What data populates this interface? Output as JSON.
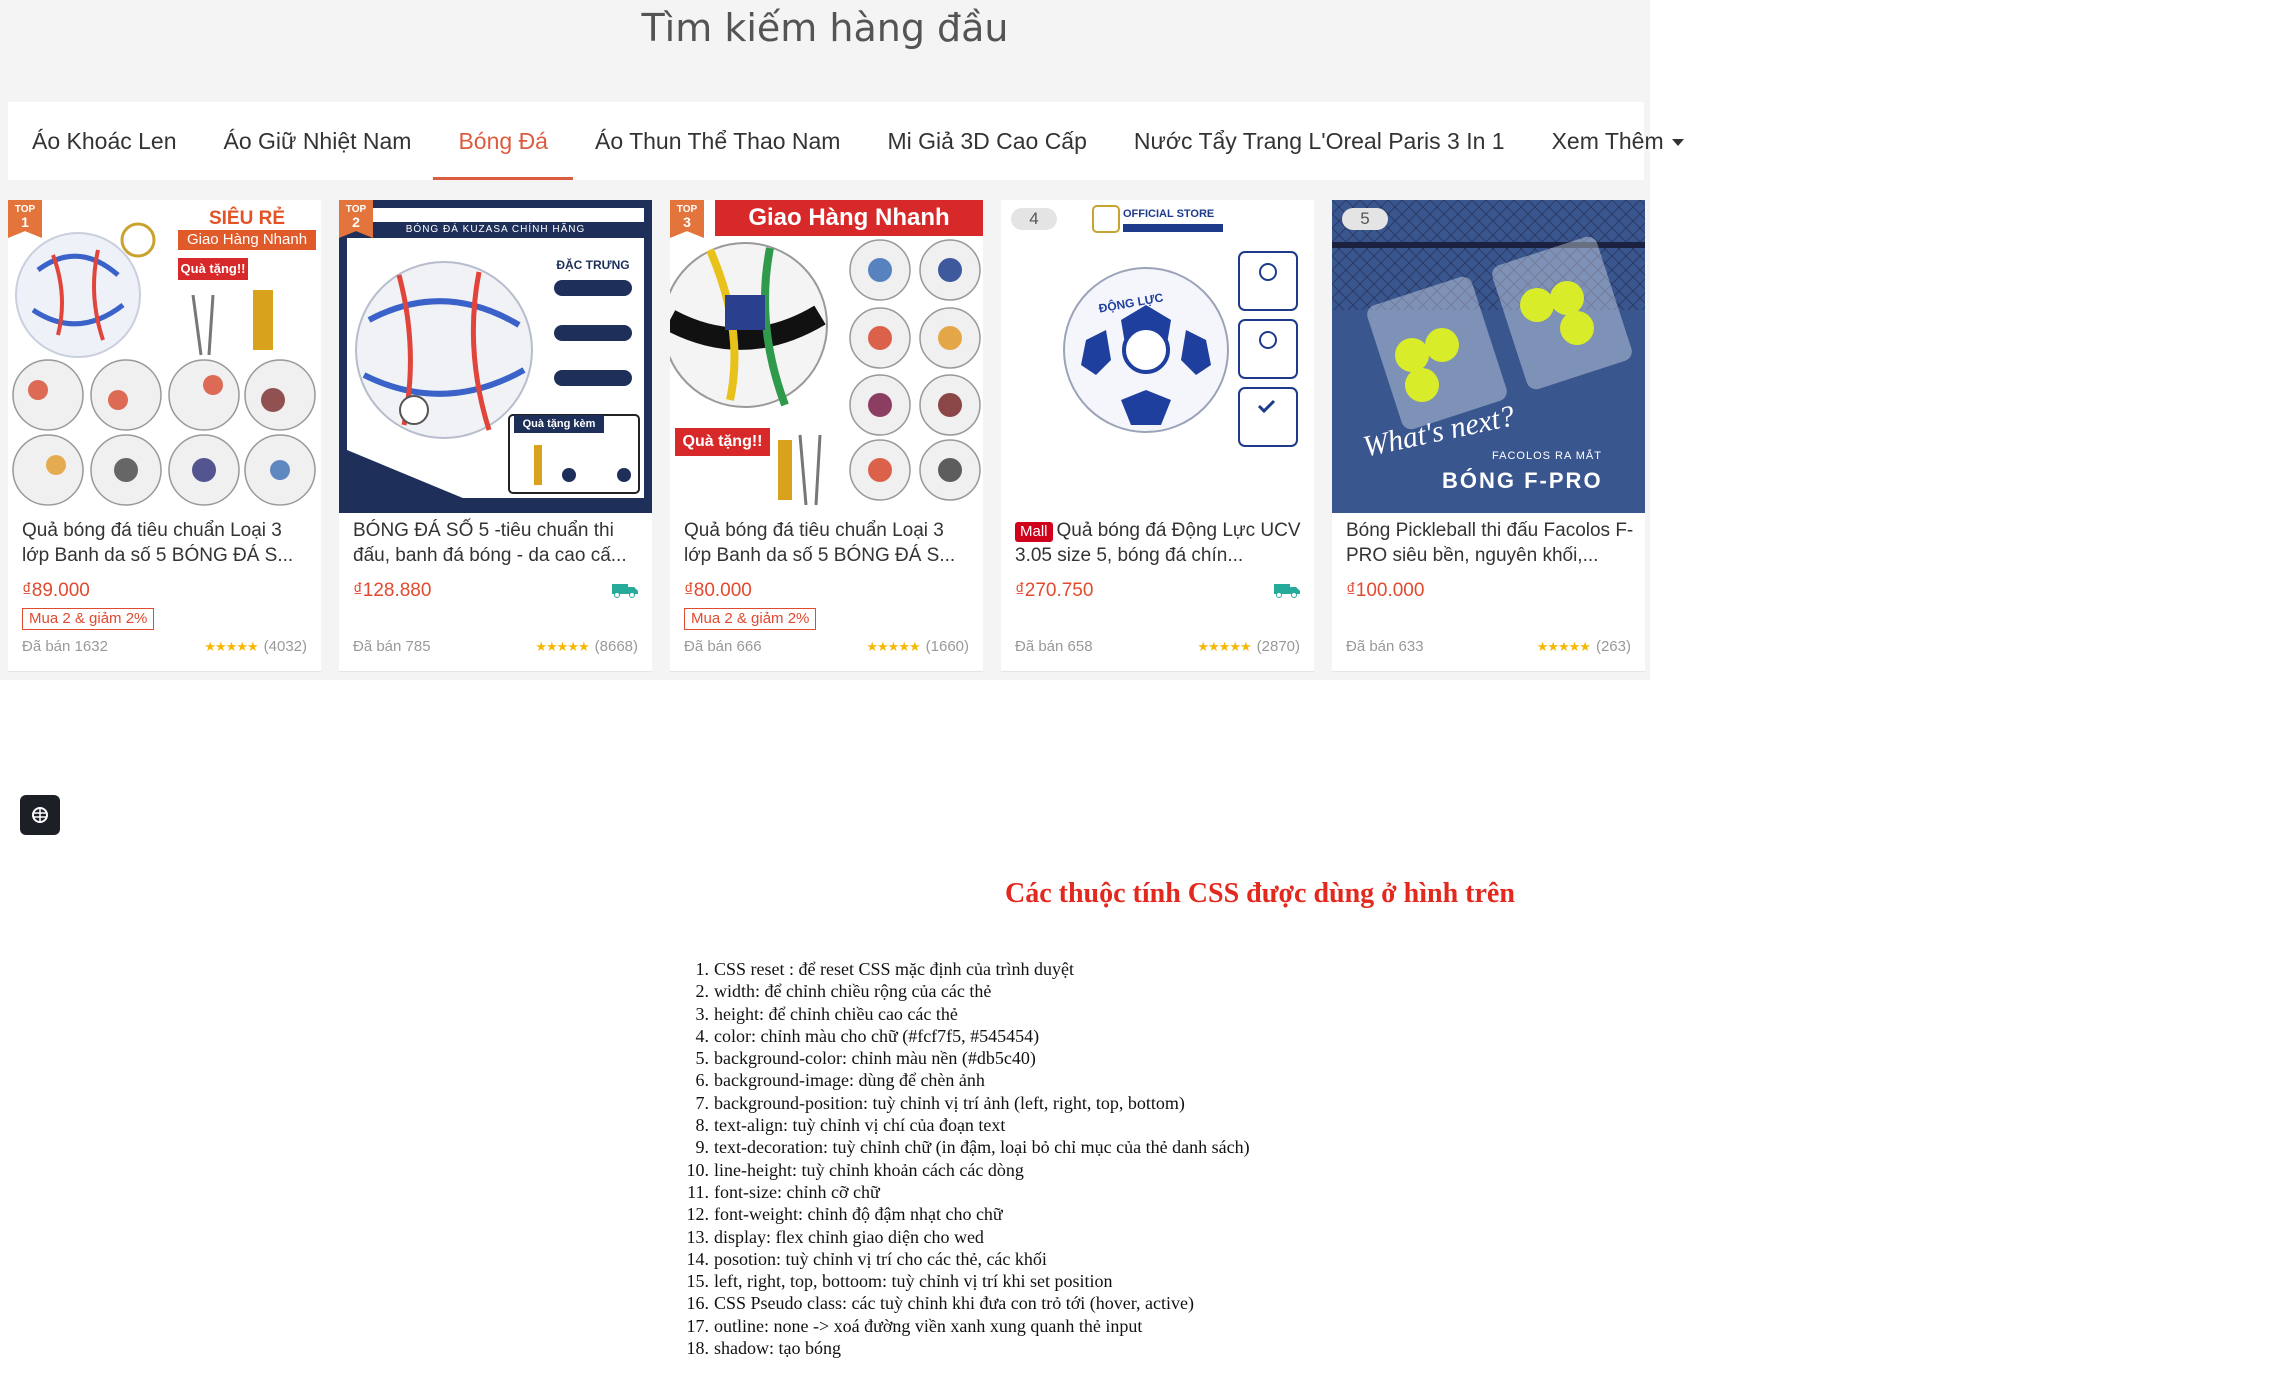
{
  "panel": {
    "title": "Tìm kiếm hàng đầu",
    "tabs": [
      {
        "label": "Áo Khoác Len"
      },
      {
        "label": "Áo Giữ Nhiệt Nam"
      },
      {
        "label": "Bóng Đá",
        "active": true
      },
      {
        "label": "Áo Thun Thể Thao Nam"
      },
      {
        "label": "Mi Giả 3D Cao Cấp"
      },
      {
        "label": "Nước Tẩy Trang L'Oreal Paris 3 In 1"
      }
    ],
    "more_label": "Xem Thêm",
    "products": [
      {
        "rank_label": "TOP",
        "rank": "1",
        "image_banner": "SIÊU RẺ",
        "image_banner2": "Giao Hàng Nhanh",
        "image_gift": "Quà tặng!!",
        "name": "Quả bóng đá tiêu chuẩn Loại 3 lớp Banh da số 5 BÓNG ĐÁ S...",
        "price": "₫89.000",
        "promo": "Mua 2 & giảm 2%",
        "sold": "Đã bán 1632",
        "rating_count": "(4032)"
      },
      {
        "rank_label": "TOP",
        "rank": "2",
        "image_banner": "BÓNG ĐÁ KUZASA CHÍNH HÃNG",
        "image_banner2": "ĐẶC TRƯNG",
        "image_gift": "Quà tặng kèm",
        "name": "BÓNG ĐÁ SỐ 5 -tiêu chuẩn thi đấu, banh đá bóng - da cao cấ...",
        "price": "₫128.880",
        "sold": "Đã bán 785",
        "rating_count": "(8668)"
      },
      {
        "rank_label": "TOP",
        "rank": "3",
        "image_banner": "Giao Hàng Nhanh",
        "image_gift": "Quà tặng!!",
        "name": "Quả bóng đá tiêu chuẩn Loại 3 lớp Banh da số 5 BÓNG ĐÁ S...",
        "price": "₫80.000",
        "promo": "Mua 2 & giảm 2%",
        "sold": "Đã bán 666",
        "rating_count": "(1660)"
      },
      {
        "rank": "4",
        "image_banner": "OFFICIAL STORE",
        "image_banner2": "ĐỘNG LỰC",
        "mall": "Mall",
        "name": "Quả bóng đá Động Lực UCV 3.05 size 5, bóng đá chín...",
        "price": "₫270.750",
        "sold": "Đã bán 658",
        "rating_count": "(2870)"
      },
      {
        "rank": "5",
        "image_banner": "What's next?",
        "image_banner2": "FACOLOS RA MẮT",
        "image_gift": "BÓNG F-PRO",
        "name": "Bóng Pickleball thi đấu Facolos F-PRO siêu bền, nguyên khối,...",
        "price": "₫100.000",
        "sold": "Đã bán 633",
        "rating_count": "(263)"
      }
    ]
  },
  "float_button": {
    "icon": "brain-icon"
  },
  "css_list": {
    "title": "Các thuộc tính CSS được dùng ở hình trên",
    "items": [
      "CSS reset : để reset CSS mặc định của trình duyệt",
      "width: để chỉnh chiều rộng của các thẻ",
      "height: để chỉnh chiều cao các thẻ",
      "color: chỉnh màu cho chữ (#fcf7f5, #545454)",
      "background-color: chỉnh màu nền (#db5c40)",
      "background-image: dùng để chèn ảnh",
      "background-position: tuỳ chỉnh vị trí ảnh (left, right, top, bottom)",
      "text-align: tuỳ chỉnh vị chí của đoạn text",
      "text-decoration: tuỳ chỉnh chữ (in đậm, loại bỏ chỉ mục của thẻ danh sách)",
      "line-height: tuỳ chỉnh khoản cách các dòng",
      "font-size: chỉnh cỡ chữ",
      "font-weight: chỉnh độ đậm nhạt cho chữ",
      "display: flex chỉnh giao diện cho wed",
      "posotion: tuỳ chỉnh vị trí cho các thẻ, các khối",
      "left, right, top, bottoom: tuỳ chỉnh vị trí khi set position",
      "CSS Pseudo class: các tuỳ chỉnh khi đưa con trỏ tới (hover, active)",
      "outline: none -> xoá đường viền xanh xung quanh thẻ input",
      "shadow: tạo bóng"
    ]
  },
  "colors": {
    "accent": "#db5c40",
    "title_gray": "#545454",
    "list_title": "#e3281e"
  }
}
